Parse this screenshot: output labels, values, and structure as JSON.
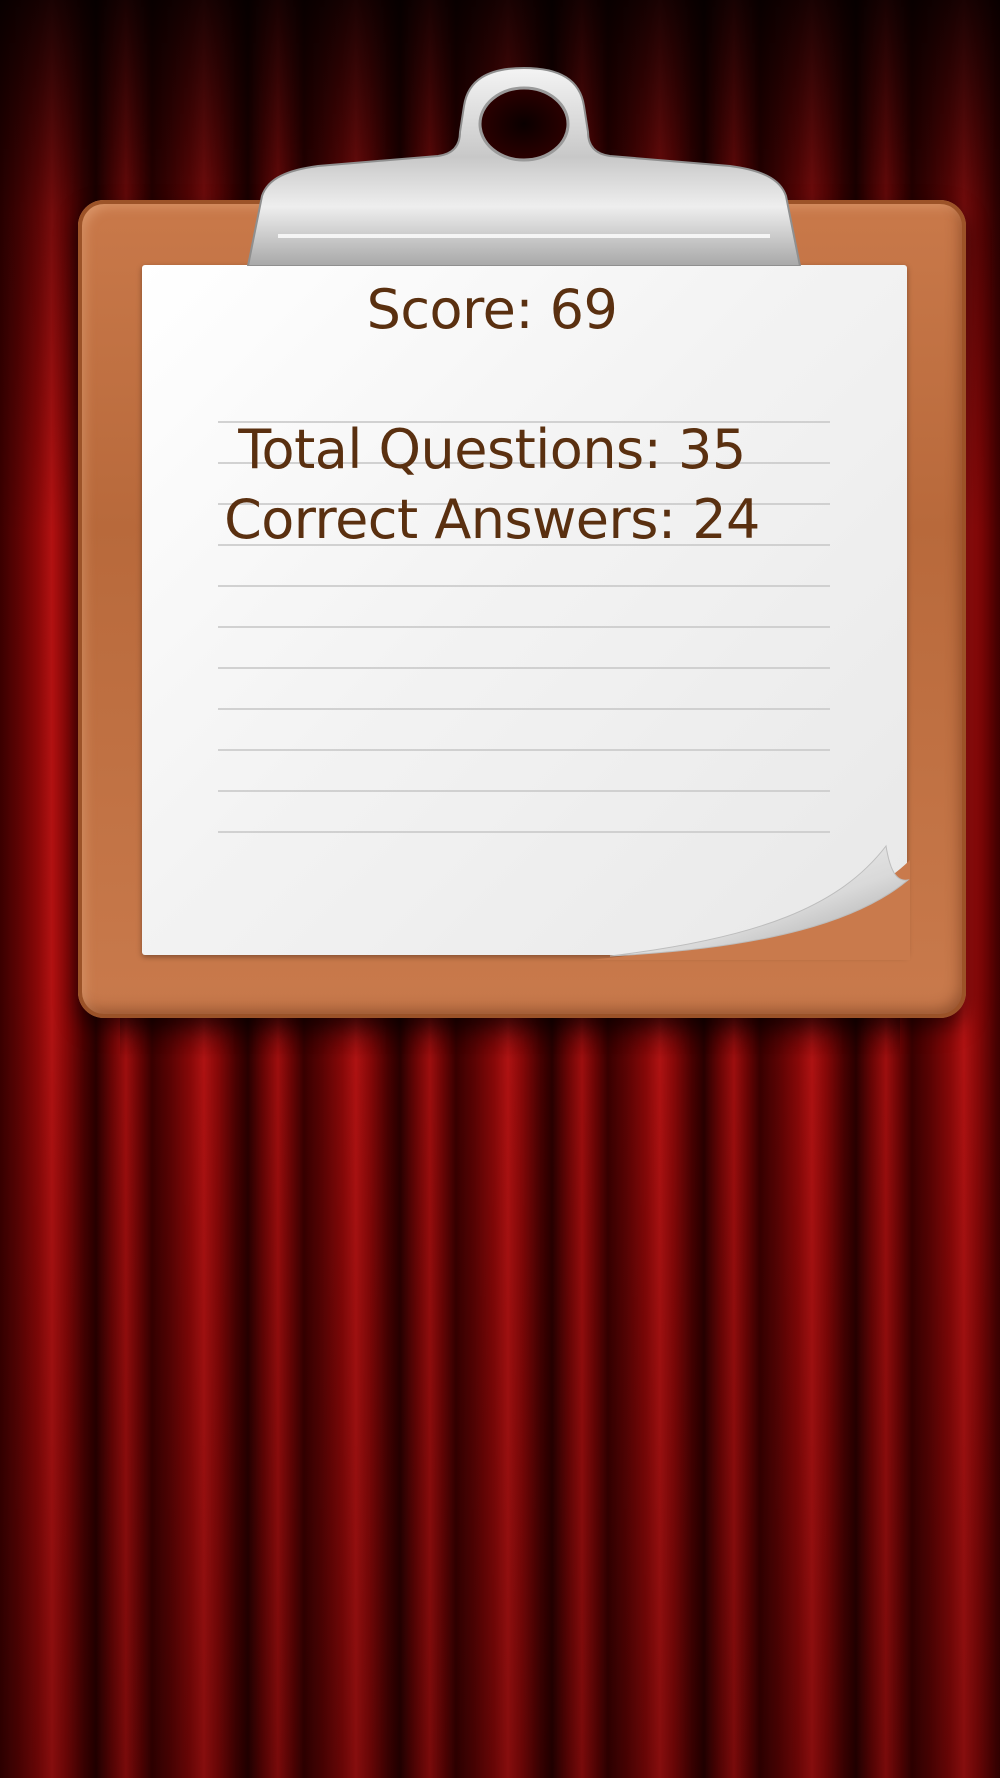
{
  "results": {
    "score_label": "Score: 69",
    "total_questions_label": "Total Questions: 35",
    "correct_answers_label": "Correct Answers: 24"
  },
  "colors": {
    "curtain_red": "#8a0808",
    "board_brown": "#c9794a",
    "text_brown": "#5a3010",
    "paper": "#f3f3f3"
  }
}
